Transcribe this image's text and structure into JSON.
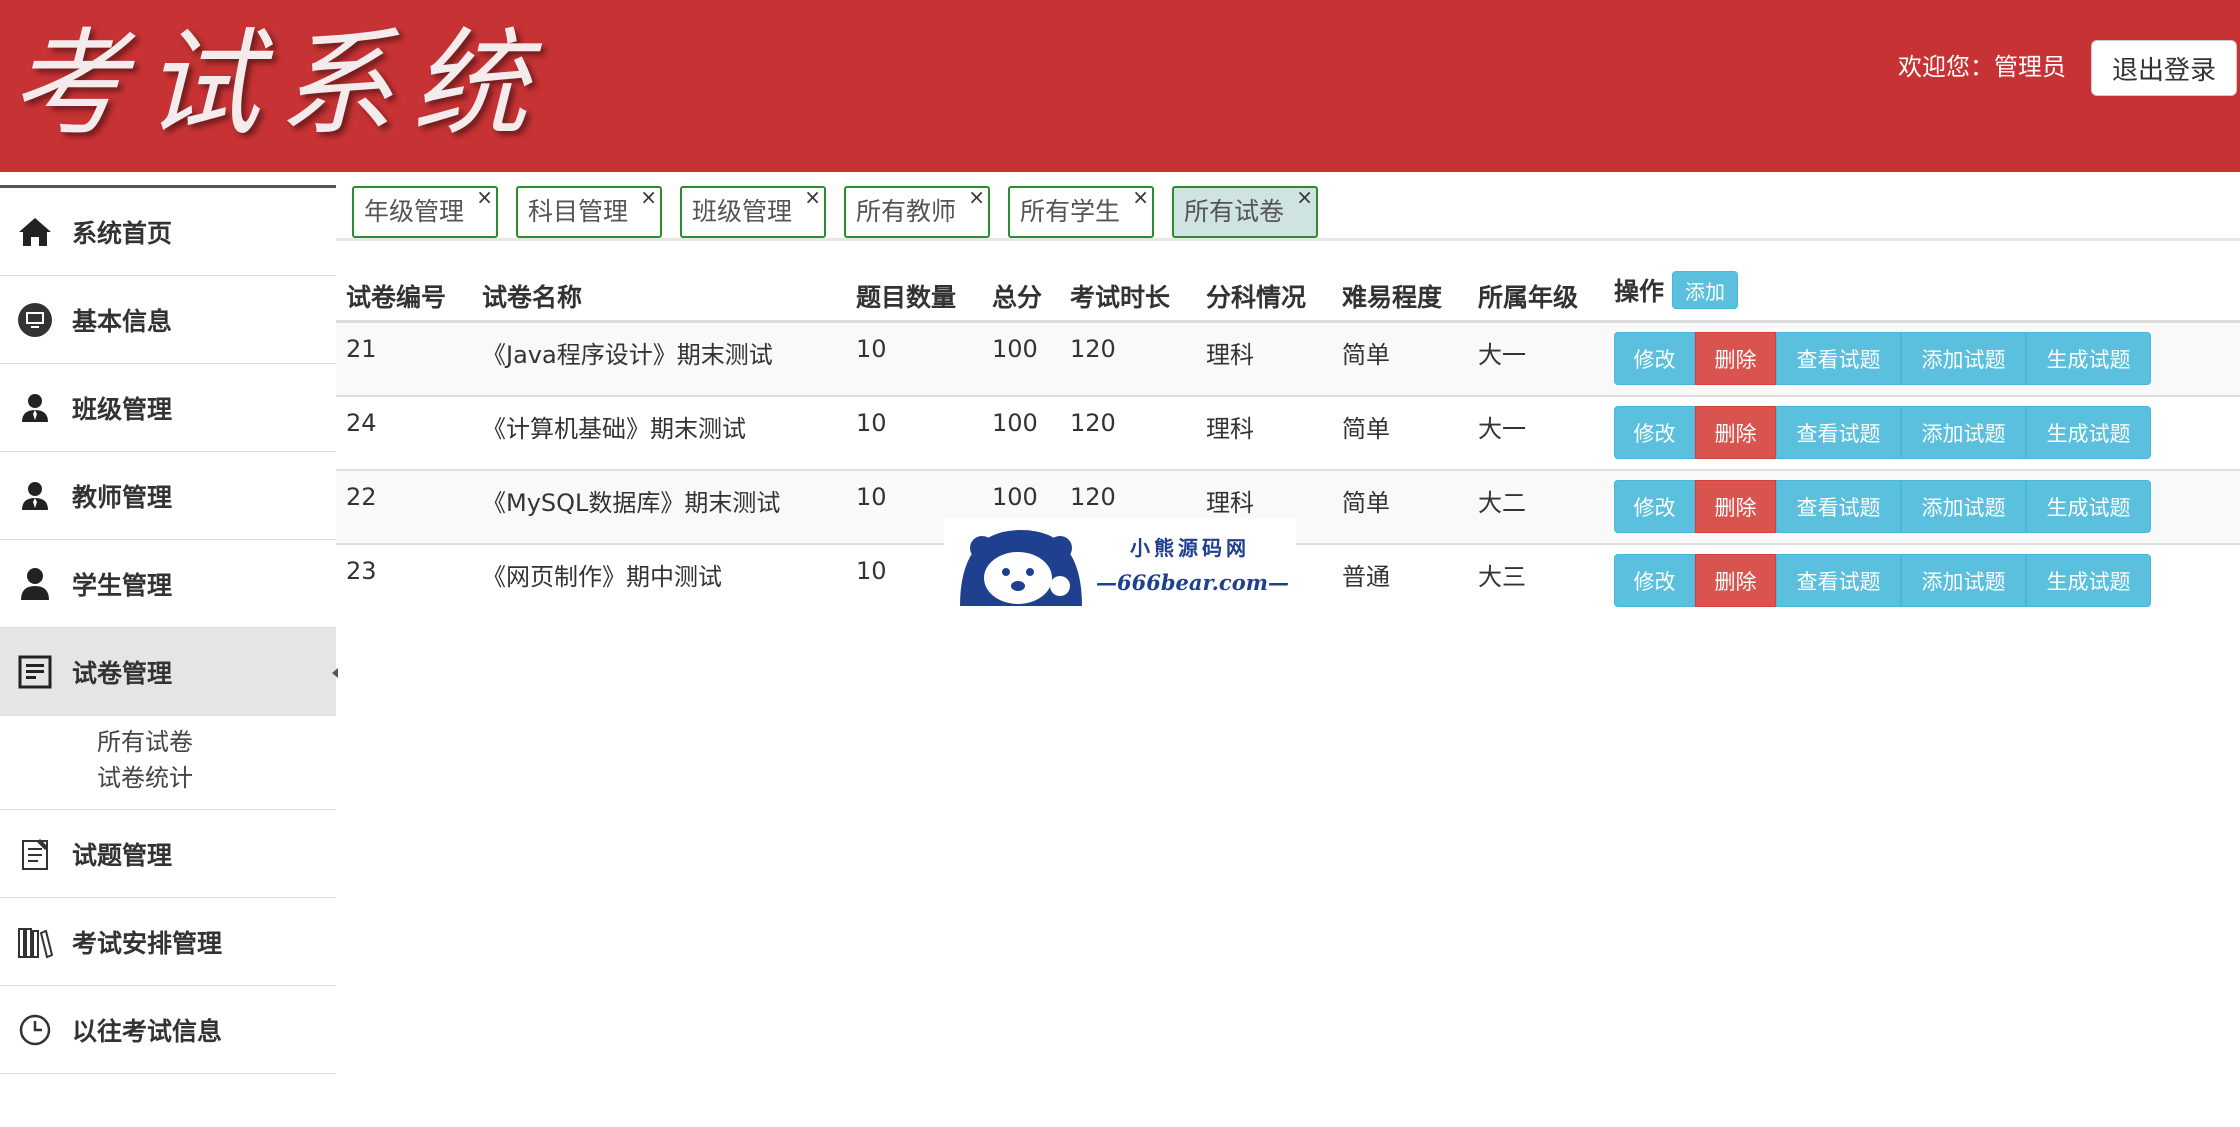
{
  "header": {
    "logo_text": "考试系统",
    "welcome_text": "欢迎您：管理员",
    "logout_label": "退出登录",
    "brand_color": "#c73234"
  },
  "sidebar": {
    "items": [
      {
        "label": "系统首页",
        "icon": "home-icon"
      },
      {
        "label": "基本信息",
        "icon": "monitor-icon"
      },
      {
        "label": "班级管理",
        "icon": "person-tie-icon"
      },
      {
        "label": "教师管理",
        "icon": "person-tie-icon"
      },
      {
        "label": "学生管理",
        "icon": "person-icon"
      },
      {
        "label": "试卷管理",
        "icon": "document-edit-icon"
      },
      {
        "label": "试题管理",
        "icon": "notepad-icon"
      },
      {
        "label": "考试安排管理",
        "icon": "books-icon"
      },
      {
        "label": "以往考试信息",
        "icon": "clock-icon"
      }
    ],
    "active_item": "试卷管理",
    "submenu": [
      "所有试卷",
      "试卷统计"
    ]
  },
  "tabs": [
    {
      "label": "年级管理",
      "active": false
    },
    {
      "label": "科目管理",
      "active": false
    },
    {
      "label": "班级管理",
      "active": false
    },
    {
      "label": "所有教师",
      "active": false
    },
    {
      "label": "所有学生",
      "active": false
    },
    {
      "label": "所有试卷",
      "active": true
    }
  ],
  "tab_close_glyph": "×",
  "table": {
    "headers": [
      "试卷编号",
      "试卷名称",
      "题目数量",
      "总分",
      "考试时长",
      "分科情况",
      "难易程度",
      "所属年级",
      "操作"
    ],
    "add_label": "添加",
    "rows": [
      [
        "21",
        "《Java程序设计》期末测试",
        "10",
        "100",
        "120",
        "理科",
        "简单",
        "大一"
      ],
      [
        "24",
        "《计算机基础》期末测试",
        "10",
        "100",
        "120",
        "理科",
        "简单",
        "大一"
      ],
      [
        "22",
        "《MySQL数据库》期末测试",
        "10",
        "100",
        "120",
        "理科",
        "简单",
        "大二"
      ],
      [
        "23",
        "《网页制作》期中测试",
        "10",
        "",
        "",
        "",
        "普通",
        "大三"
      ]
    ],
    "actions": [
      "修改",
      "删除",
      "查看试题",
      "添加试题",
      "生成试题"
    ]
  },
  "watermark": {
    "brand": "小熊源码网",
    "url": "—666bear.com—"
  }
}
